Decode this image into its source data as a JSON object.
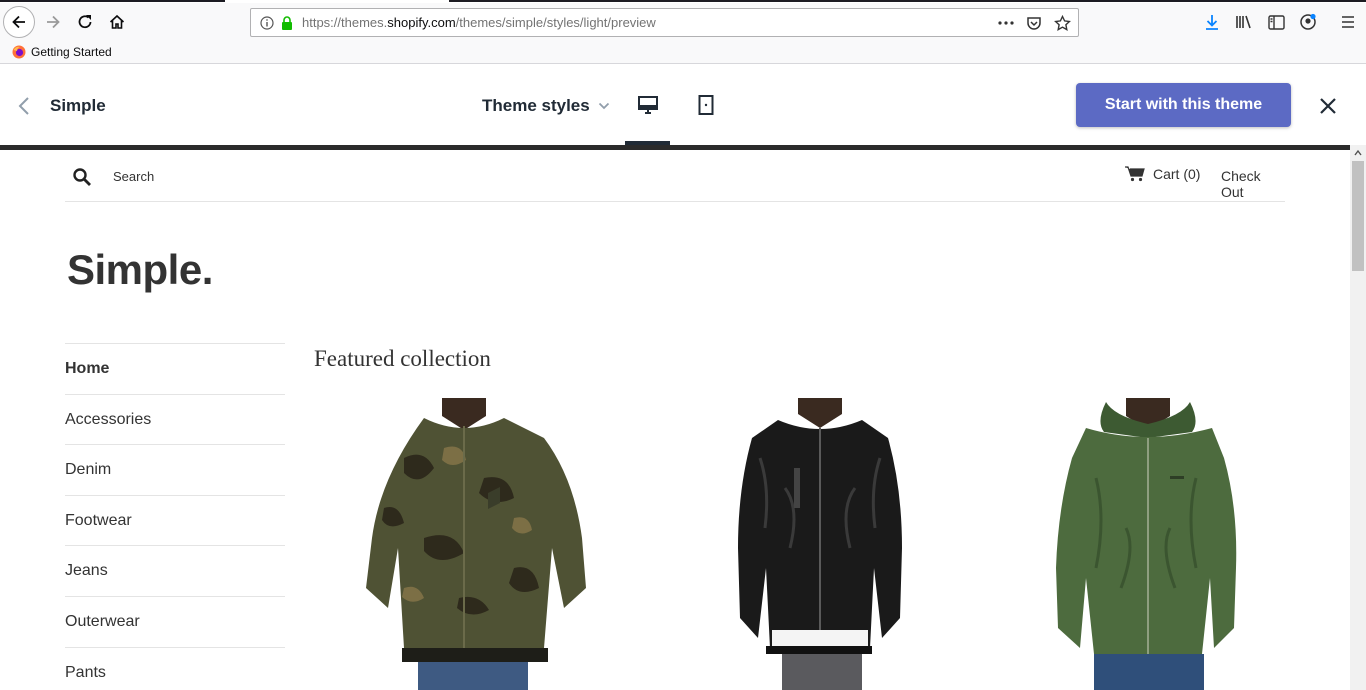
{
  "browser": {
    "url_prefix": "https://themes.",
    "url_domain": "shopify.com",
    "url_path": "/themes/simple/styles/light/preview",
    "bookmark_label": "Getting Started"
  },
  "preview": {
    "theme_name": "Simple",
    "theme_styles_label": "Theme styles",
    "start_button_label": "Start with this theme",
    "accent_color": "#5c6ac4"
  },
  "store": {
    "search_label": "Search",
    "cart_label": "Cart (0)",
    "checkout_label": "Check Out",
    "logo": "Simple.",
    "nav": [
      {
        "label": "Home"
      },
      {
        "label": "Accessories"
      },
      {
        "label": "Denim"
      },
      {
        "label": "Footwear"
      },
      {
        "label": "Jeans"
      },
      {
        "label": "Outerwear"
      },
      {
        "label": "Pants"
      }
    ],
    "featured_title": "Featured collection",
    "products": [
      {
        "image": "camo-bomber-jacket-photo"
      },
      {
        "image": "black-leather-jacket-photo"
      },
      {
        "image": "green-windbreaker-jacket-photo"
      }
    ]
  }
}
